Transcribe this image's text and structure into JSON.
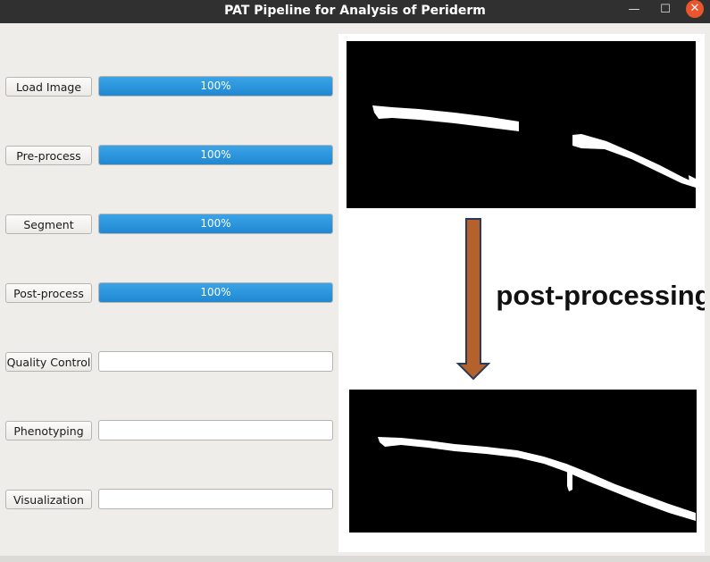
{
  "window": {
    "title": "PAT Pipeline for Analysis of Periderm",
    "minimize_glyph": "—",
    "maximize_glyph": "☐",
    "close_glyph": "✕"
  },
  "steps": [
    {
      "label": "Load Image",
      "progress": 100,
      "progress_text": "100%"
    },
    {
      "label": "Pre-process",
      "progress": 100,
      "progress_text": "100%"
    },
    {
      "label": "Segment",
      "progress": 100,
      "progress_text": "100%"
    },
    {
      "label": "Post-process",
      "progress": 100,
      "progress_text": "100%"
    },
    {
      "label": "Quality Control",
      "progress": 0,
      "progress_text": ""
    },
    {
      "label": "Phenotyping",
      "progress": 0,
      "progress_text": ""
    },
    {
      "label": "Visualization",
      "progress": 0,
      "progress_text": ""
    }
  ],
  "illustration": {
    "caption": "post-processing",
    "colors": {
      "arrow_fill": "#b5612c",
      "arrow_stroke": "#2b3a5a",
      "mask_background": "#000000",
      "mask_foreground": "#ffffff",
      "progress_fill": "#2b95dc"
    }
  }
}
